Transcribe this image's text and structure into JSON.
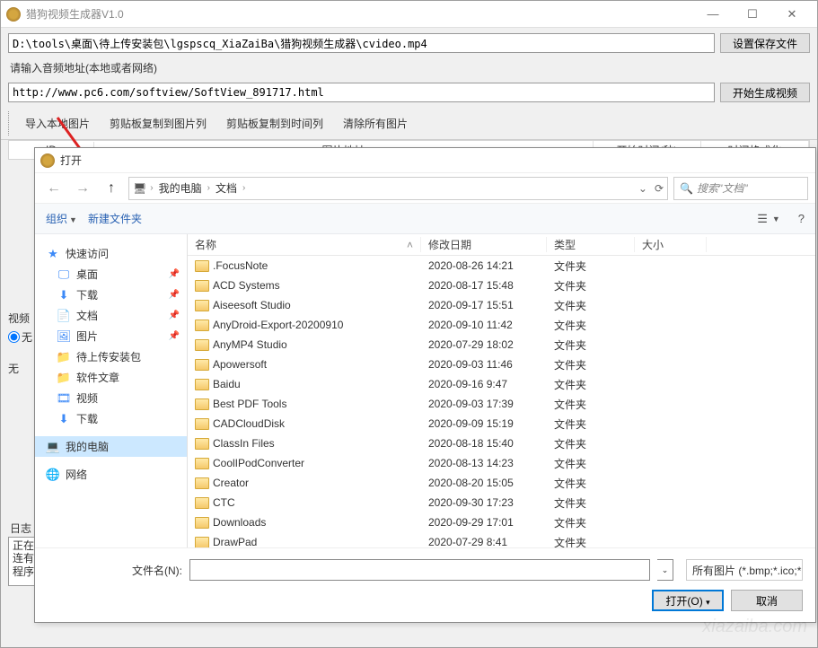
{
  "main": {
    "title": "猎狗视频生成器V1.0",
    "video_path": "D:\\tools\\桌面\\待上传安装包\\lgspscq_XiaZaiBa\\猎狗视频生成器\\cvideo.mp4",
    "set_save_btn": "设置保存文件",
    "audio_label": "请输入音频地址(本地或者网络)",
    "audio_url": "http://www.pc6.com/softview/SoftView_891717.html",
    "start_btn": "开始生成视频",
    "toolbar": {
      "import": "导入本地图片",
      "paste_img": "剪贴板复制到图片列",
      "paste_time": "剪贴板复制到时间列",
      "clear": "清除所有图片"
    },
    "cols": {
      "id": "ID",
      "addr": "图片地址",
      "start": "开始时间(秒)",
      "fmt": "时间格式化"
    },
    "left": {
      "label": "视频",
      "radio_none": "无",
      "none_below": "无"
    },
    "log_label": "日志",
    "log_text": "正在执\n连有网\n程序结"
  },
  "dialog": {
    "title": "打开",
    "crumbs": [
      "我的电脑",
      "文档"
    ],
    "search_ph": "搜索\"文档\"",
    "organize": "组织",
    "new_folder": "新建文件夹",
    "sidebar": {
      "quick": "快速访问",
      "desktop": "桌面",
      "downloads": "下载",
      "documents": "文档",
      "pictures": "图片",
      "pending": "待上传安装包",
      "soft": "软件文章",
      "video": "视频",
      "downloads2": "下载",
      "pc": "我的电脑",
      "network": "网络"
    },
    "cols": {
      "name": "名称",
      "date": "修改日期",
      "type": "类型",
      "size": "大小"
    },
    "rows": [
      {
        "name": ".FocusNote",
        "date": "2020-08-26 14:21",
        "type": "文件夹"
      },
      {
        "name": "ACD Systems",
        "date": "2020-08-17 15:48",
        "type": "文件夹"
      },
      {
        "name": "Aiseesoft Studio",
        "date": "2020-09-17 15:51",
        "type": "文件夹"
      },
      {
        "name": "AnyDroid-Export-20200910",
        "date": "2020-09-10 11:42",
        "type": "文件夹"
      },
      {
        "name": "AnyMP4 Studio",
        "date": "2020-07-29 18:02",
        "type": "文件夹"
      },
      {
        "name": "Apowersoft",
        "date": "2020-09-03 11:46",
        "type": "文件夹"
      },
      {
        "name": "Baidu",
        "date": "2020-09-16 9:47",
        "type": "文件夹"
      },
      {
        "name": "Best PDF Tools",
        "date": "2020-09-03 17:39",
        "type": "文件夹"
      },
      {
        "name": "CADCloudDisk",
        "date": "2020-09-09 15:19",
        "type": "文件夹"
      },
      {
        "name": "ClassIn Files",
        "date": "2020-08-18 15:40",
        "type": "文件夹"
      },
      {
        "name": "CoolIPodConverter",
        "date": "2020-08-13 14:23",
        "type": "文件夹"
      },
      {
        "name": "Creator",
        "date": "2020-08-20 15:05",
        "type": "文件夹"
      },
      {
        "name": "CTC",
        "date": "2020-09-30 17:23",
        "type": "文件夹"
      },
      {
        "name": "Downloads",
        "date": "2020-09-29 17:01",
        "type": "文件夹"
      },
      {
        "name": "DrawPad",
        "date": "2020-07-29 8:41",
        "type": "文件夹"
      }
    ],
    "filename_label": "文件名(N):",
    "filename_value": "",
    "filter": "所有图片 (*.bmp;*.ico;*.",
    "open_btn": "打开(O)",
    "cancel_btn": "取消"
  },
  "watermark": "xiazaiba.com"
}
